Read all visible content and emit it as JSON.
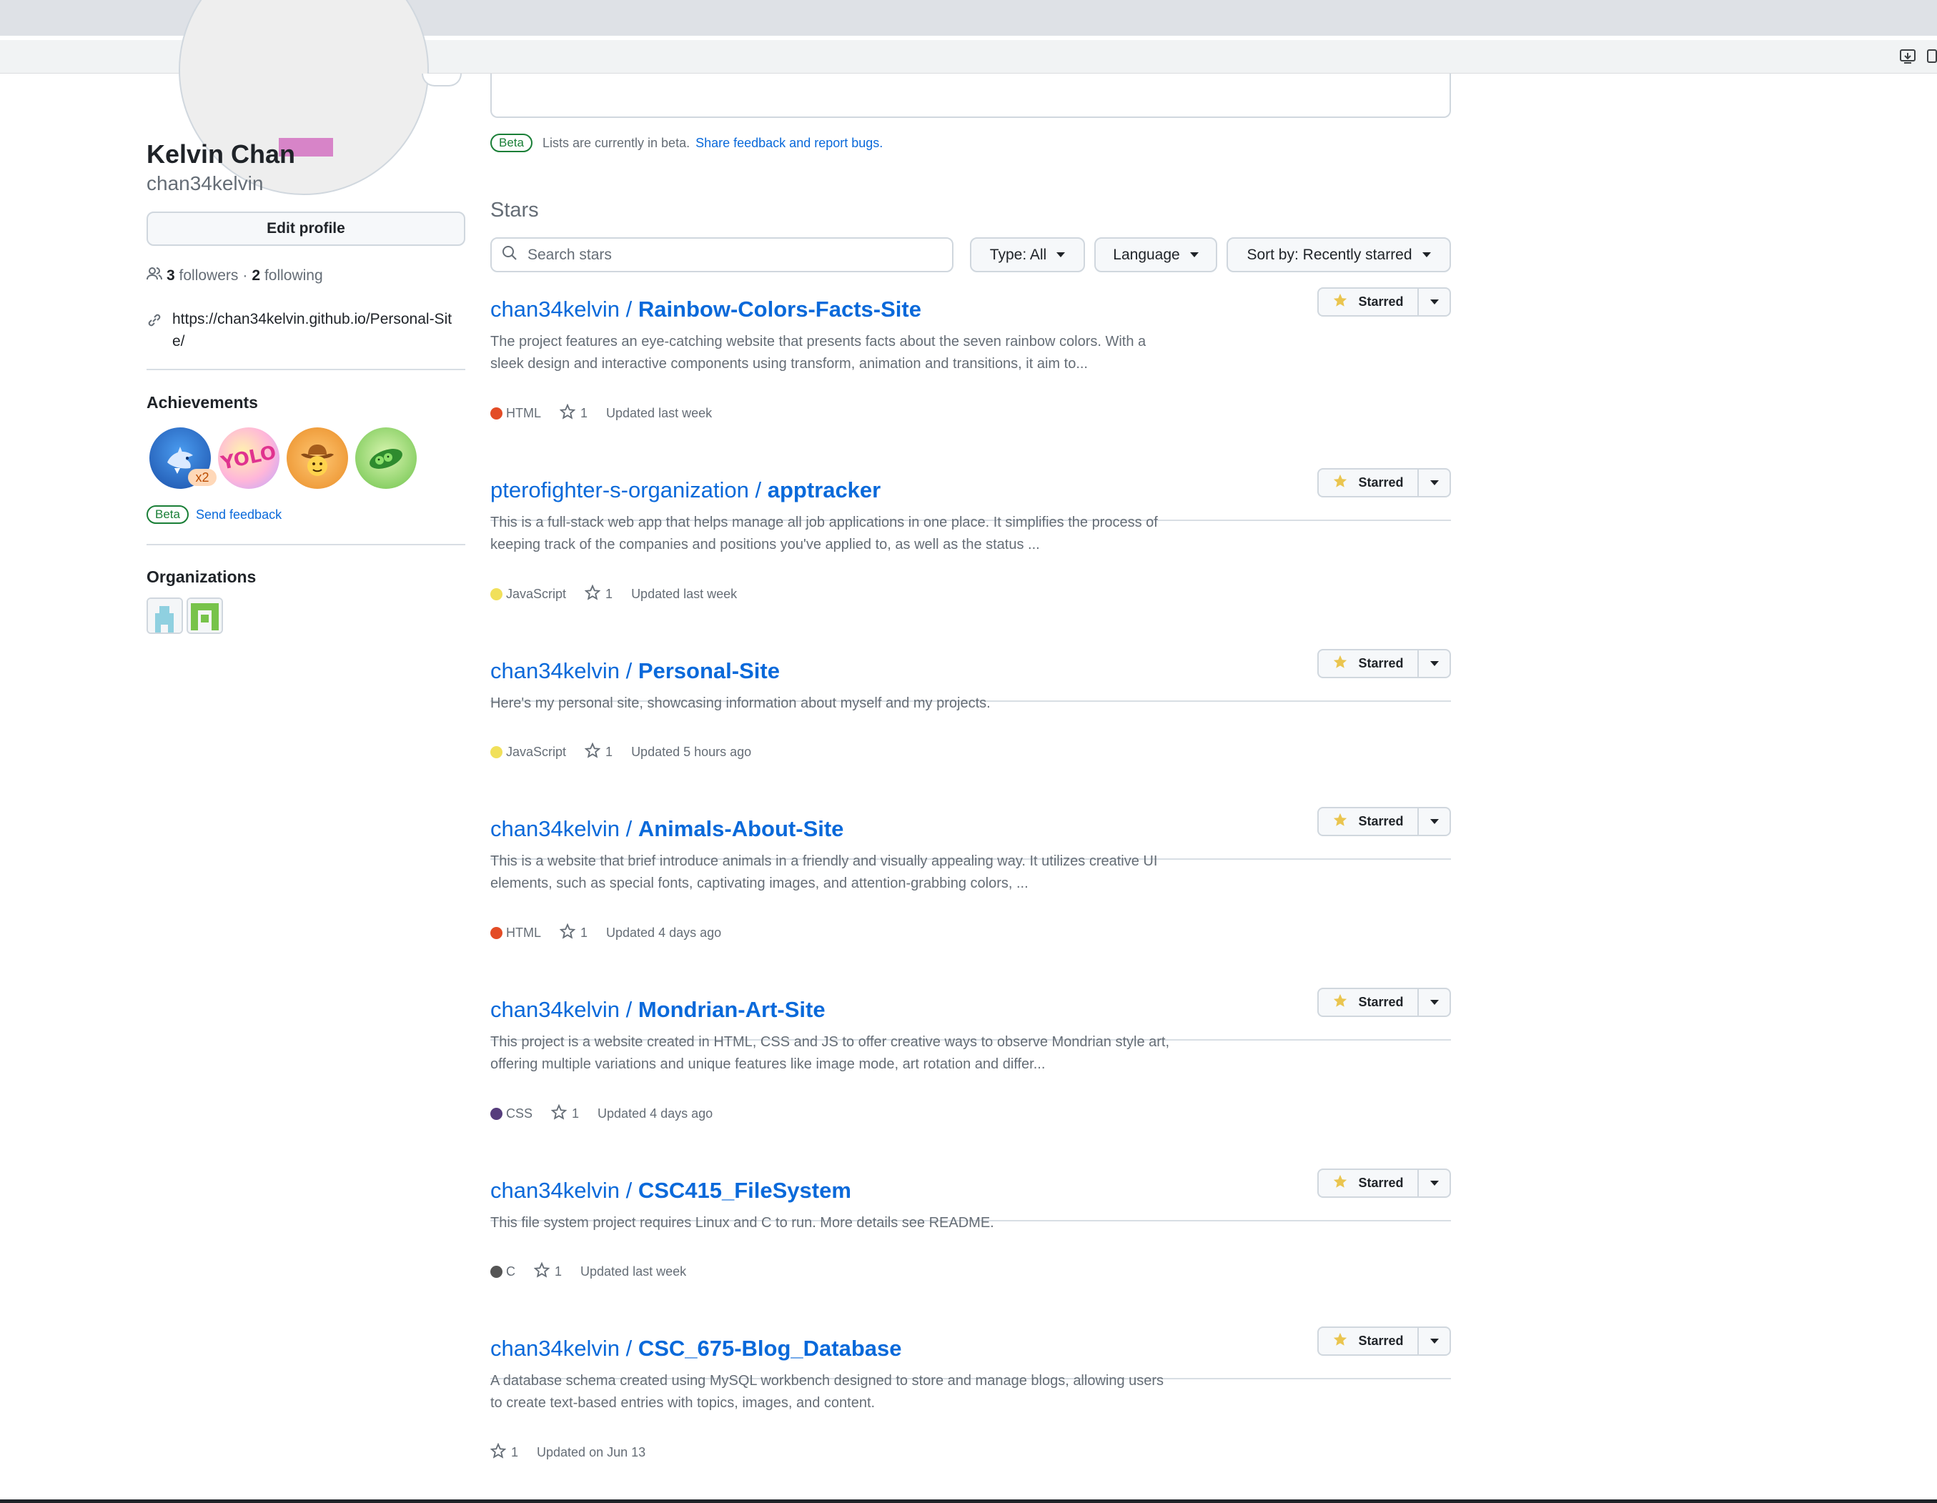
{
  "profile": {
    "name": "Kelvin Chan",
    "login": "chan34kelvin",
    "edit_label": "Edit profile",
    "followers_count": "3",
    "followers_label": "followers",
    "separator": "·",
    "following_count": "2",
    "following_label": "following",
    "website": "https://chan34kelvin.github.io/Personal-Site/"
  },
  "achievements": {
    "title": "Achievements",
    "badges": [
      {
        "name": "shark-badge",
        "count": "x2"
      },
      {
        "name": "yolo-badge",
        "text": "YOLO"
      },
      {
        "name": "cowboy-badge"
      },
      {
        "name": "pea-pod-badge"
      }
    ],
    "beta_label": "Beta",
    "feedback_label": "Send feedback"
  },
  "organizations": {
    "title": "Organizations"
  },
  "lists": {
    "beta_label": "Beta",
    "beta_text": "Lists are currently in beta.",
    "feedback_link": "Share feedback and report bugs."
  },
  "stars": {
    "heading": "Stars",
    "search_placeholder": "Search stars",
    "type_filter": "Type: All",
    "language_filter": "Language",
    "sort_filter": "Sort by: Recently starred",
    "starred_label": "Starred"
  },
  "repos": [
    {
      "owner": "chan34kelvin / ",
      "name": "Rainbow-Colors-Facts-Site",
      "description": "The project features an eye-catching website that presents facts about the seven rainbow colors. With a sleek design and interactive components using transform, animation and transitions, it aim to...",
      "language": "HTML",
      "lang_color": "#e34c26",
      "stars": "1",
      "updated": "Updated last week"
    },
    {
      "owner": "pterofighter-s-organization / ",
      "name": "apptracker",
      "description": "This is a full-stack web app that helps manage all job applications in one place. It simplifies the process of keeping track of the companies and positions you've applied to, as well as the status ...",
      "language": "JavaScript",
      "lang_color": "#f1e05a",
      "stars": "1",
      "updated": "Updated last week"
    },
    {
      "owner": "chan34kelvin / ",
      "name": "Personal-Site",
      "description": "Here's my personal site, showcasing information about myself and my projects.",
      "language": "JavaScript",
      "lang_color": "#f1e05a",
      "stars": "1",
      "updated": "Updated 5 hours ago"
    },
    {
      "owner": "chan34kelvin / ",
      "name": "Animals-About-Site",
      "description": "This is a website that brief introduce animals in a friendly and visually appealing way. It utilizes creative UI elements, such as special fonts, captivating images, and attention-grabbing colors, ...",
      "language": "HTML",
      "lang_color": "#e34c26",
      "stars": "1",
      "updated": "Updated 4 days ago"
    },
    {
      "owner": "chan34kelvin / ",
      "name": "Mondrian-Art-Site",
      "description": "This project is a website created in HTML, CSS and JS to offer creative ways to observe Mondrian style art, offering multiple variations and unique features like image mode, art rotation and differ...",
      "language": "CSS",
      "lang_color": "#563d7c",
      "stars": "1",
      "updated": "Updated 4 days ago"
    },
    {
      "owner": "chan34kelvin / ",
      "name": "CSC415_FileSystem",
      "description": "This file system project requires Linux and C to run. More details see README.",
      "language": "C",
      "lang_color": "#555555",
      "stars": "1",
      "updated": "Updated last week"
    },
    {
      "owner": "chan34kelvin / ",
      "name": "CSC_675-Blog_Database",
      "description": "A database schema created using MySQL workbench designed to store and manage blogs, allowing users to create text-based entries with topics, images, and content.",
      "language": "",
      "lang_color": "",
      "stars": "1",
      "updated": "Updated on Jun 13"
    }
  ]
}
